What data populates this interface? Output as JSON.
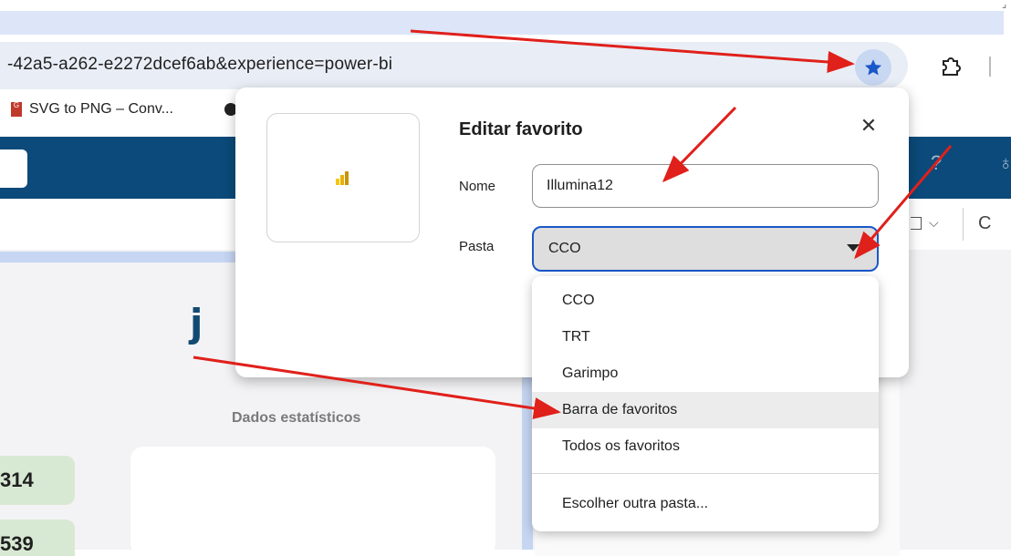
{
  "browser": {
    "url_text": "-42a5-a262-e2272dcef6ab&experience=power-bi",
    "bookmark_label": "SVG to PNG – Conv...",
    "favicon_letters": "G",
    "corner_glyph": "⌟"
  },
  "app": {
    "header_help_glyph": "?",
    "header_user_glyph": "♁",
    "toolbar_chevron_glyph": "⌵",
    "toolbar_refresh_glyph": "C",
    "logo_glyph": "j",
    "stats_title": "Dados estatísticos",
    "kpi_values": [
      "314",
      "539"
    ]
  },
  "dialog": {
    "title": "Editar favorito",
    "close_glyph": "✕",
    "name_label": "Nome",
    "name_value": "Illumina12",
    "folder_label": "Pasta",
    "folder_value": "CCO",
    "folder_options": [
      "CCO",
      "TRT",
      "Garimpo",
      "Barra de favoritos",
      "Todos os favoritos"
    ],
    "other_folder_option": "Escolher outra pasta..."
  },
  "colors": {
    "accent": "#1a57c8",
    "header": "#0b4a7a",
    "annotation": "#e0201b"
  },
  "icons": {
    "star": "star-icon",
    "extensions": "puzzle-icon",
    "close": "close-icon",
    "dropdown": "caret-down-icon",
    "powerbi": "powerbi-icon"
  }
}
